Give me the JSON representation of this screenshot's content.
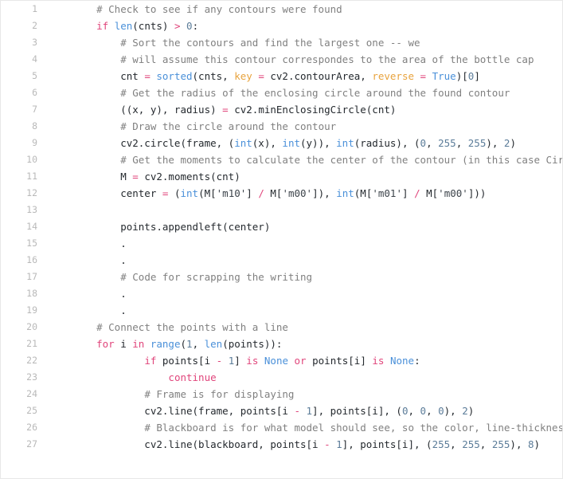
{
  "viewer": {
    "language": "python",
    "first_line": 1,
    "last_line": 27,
    "total_lines": 27,
    "background": "#ffffff",
    "border_color": "#e8e8e8",
    "gutter_color": "#b9b9b9"
  },
  "theme": {
    "comment": "#808080",
    "keyword": "#e0457b",
    "builtin": "#4a90d9",
    "number": "#5b7c99",
    "operator": "#e0457b",
    "parameter": "#e8a33d",
    "string": "#3d444b",
    "plain": "#24292e"
  },
  "lines": [
    {
      "number": "1",
      "text": "    # Check to see if any contours were found",
      "tokens": [
        {
          "t": "    ",
          "c": "pl"
        },
        {
          "t": "# Check to see if any contours were found",
          "c": "cmt"
        }
      ]
    },
    {
      "number": "2",
      "text": "    if len(cnts) > 0:",
      "tokens": [
        {
          "t": "    ",
          "c": "pl"
        },
        {
          "t": "if",
          "c": "kw"
        },
        {
          "t": " ",
          "c": "pl"
        },
        {
          "t": "len",
          "c": "bi"
        },
        {
          "t": "(cnts) ",
          "c": "pl"
        },
        {
          "t": ">",
          "c": "op"
        },
        {
          "t": " ",
          "c": "pl"
        },
        {
          "t": "0",
          "c": "num"
        },
        {
          "t": ":",
          "c": "pl"
        }
      ]
    },
    {
      "number": "3",
      "text": "        # Sort the contours and find the largest one -- we",
      "tokens": [
        {
          "t": "        ",
          "c": "pl"
        },
        {
          "t": "# Sort the contours and find the largest one -- we",
          "c": "cmt"
        }
      ]
    },
    {
      "number": "4",
      "text": "        # will assume this contour correspondes to the area of the bottle cap",
      "tokens": [
        {
          "t": "        ",
          "c": "pl"
        },
        {
          "t": "# will assume this contour correspondes to the area of the bottle cap",
          "c": "cmt"
        }
      ]
    },
    {
      "number": "5",
      "text": "        cnt = sorted(cnts, key = cv2.contourArea, reverse = True)[0]",
      "tokens": [
        {
          "t": "        cnt ",
          "c": "pl"
        },
        {
          "t": "=",
          "c": "op"
        },
        {
          "t": " ",
          "c": "pl"
        },
        {
          "t": "sorted",
          "c": "bi"
        },
        {
          "t": "(cnts, ",
          "c": "pl"
        },
        {
          "t": "key",
          "c": "par"
        },
        {
          "t": " ",
          "c": "pl"
        },
        {
          "t": "=",
          "c": "op"
        },
        {
          "t": " cv2.contourArea, ",
          "c": "pl"
        },
        {
          "t": "reverse",
          "c": "par"
        },
        {
          "t": " ",
          "c": "pl"
        },
        {
          "t": "=",
          "c": "op"
        },
        {
          "t": " ",
          "c": "pl"
        },
        {
          "t": "True",
          "c": "bi"
        },
        {
          "t": ")[",
          "c": "pl"
        },
        {
          "t": "0",
          "c": "num"
        },
        {
          "t": "]",
          "c": "pl"
        }
      ]
    },
    {
      "number": "6",
      "text": "        # Get the radius of the enclosing circle around the found contour",
      "tokens": [
        {
          "t": "        ",
          "c": "pl"
        },
        {
          "t": "# Get the radius of the enclosing circle around the found contour",
          "c": "cmt"
        }
      ]
    },
    {
      "number": "7",
      "text": "        ((x, y), radius) = cv2.minEnclosingCircle(cnt)",
      "tokens": [
        {
          "t": "        ((x, y), radius) ",
          "c": "pl"
        },
        {
          "t": "=",
          "c": "op"
        },
        {
          "t": " cv2.minEnclosingCircle(cnt)",
          "c": "pl"
        }
      ]
    },
    {
      "number": "8",
      "text": "        # Draw the circle around the contour",
      "tokens": [
        {
          "t": "        ",
          "c": "pl"
        },
        {
          "t": "# Draw the circle around the contour",
          "c": "cmt"
        }
      ]
    },
    {
      "number": "9",
      "text": "        cv2.circle(frame, (int(x), int(y)), int(radius), (0, 255, 255), 2)",
      "tokens": [
        {
          "t": "        cv2.circle(frame, (",
          "c": "pl"
        },
        {
          "t": "int",
          "c": "bi"
        },
        {
          "t": "(x), ",
          "c": "pl"
        },
        {
          "t": "int",
          "c": "bi"
        },
        {
          "t": "(y)), ",
          "c": "pl"
        },
        {
          "t": "int",
          "c": "bi"
        },
        {
          "t": "(radius), (",
          "c": "pl"
        },
        {
          "t": "0",
          "c": "num"
        },
        {
          "t": ", ",
          "c": "pl"
        },
        {
          "t": "255",
          "c": "num"
        },
        {
          "t": ", ",
          "c": "pl"
        },
        {
          "t": "255",
          "c": "num"
        },
        {
          "t": "), ",
          "c": "pl"
        },
        {
          "t": "2",
          "c": "num"
        },
        {
          "t": ")",
          "c": "pl"
        }
      ]
    },
    {
      "number": "10",
      "text": "        # Get the moments to calculate the center of the contour (in this case Circle)",
      "tokens": [
        {
          "t": "        ",
          "c": "pl"
        },
        {
          "t": "# Get the moments to calculate the center of the contour (in this case Circle)",
          "c": "cmt"
        }
      ]
    },
    {
      "number": "11",
      "text": "        M = cv2.moments(cnt)",
      "tokens": [
        {
          "t": "        M ",
          "c": "pl"
        },
        {
          "t": "=",
          "c": "op"
        },
        {
          "t": " cv2.moments(cnt)",
          "c": "pl"
        }
      ]
    },
    {
      "number": "12",
      "text": "        center = (int(M['m10'] / M['m00']), int(M['m01'] / M['m00']))",
      "tokens": [
        {
          "t": "        center ",
          "c": "pl"
        },
        {
          "t": "=",
          "c": "op"
        },
        {
          "t": " (",
          "c": "pl"
        },
        {
          "t": "int",
          "c": "bi"
        },
        {
          "t": "(M[",
          "c": "pl"
        },
        {
          "t": "'m10'",
          "c": "str"
        },
        {
          "t": "] ",
          "c": "pl"
        },
        {
          "t": "/",
          "c": "op"
        },
        {
          "t": " M[",
          "c": "pl"
        },
        {
          "t": "'m00'",
          "c": "str"
        },
        {
          "t": "]), ",
          "c": "pl"
        },
        {
          "t": "int",
          "c": "bi"
        },
        {
          "t": "(M[",
          "c": "pl"
        },
        {
          "t": "'m01'",
          "c": "str"
        },
        {
          "t": "] ",
          "c": "pl"
        },
        {
          "t": "/",
          "c": "op"
        },
        {
          "t": " M[",
          "c": "pl"
        },
        {
          "t": "'m00'",
          "c": "str"
        },
        {
          "t": "]))",
          "c": "pl"
        }
      ]
    },
    {
      "number": "13",
      "text": "",
      "tokens": []
    },
    {
      "number": "14",
      "text": "        points.appendleft(center)",
      "tokens": [
        {
          "t": "        points.appendleft(center)",
          "c": "pl"
        }
      ]
    },
    {
      "number": "15",
      "text": "        .",
      "tokens": [
        {
          "t": "        .",
          "c": "pl"
        }
      ]
    },
    {
      "number": "16",
      "text": "        .",
      "tokens": [
        {
          "t": "        .",
          "c": "pl"
        }
      ]
    },
    {
      "number": "17",
      "text": "        # Code for scrapping the writing",
      "tokens": [
        {
          "t": "        ",
          "c": "pl"
        },
        {
          "t": "# Code for scrapping the writing",
          "c": "cmt"
        }
      ]
    },
    {
      "number": "18",
      "text": "        .",
      "tokens": [
        {
          "t": "        .",
          "c": "pl"
        }
      ]
    },
    {
      "number": "19",
      "text": "        .",
      "tokens": [
        {
          "t": "        .",
          "c": "pl"
        }
      ]
    },
    {
      "number": "20",
      "text": "    # Connect the points with a line",
      "tokens": [
        {
          "t": "    ",
          "c": "pl"
        },
        {
          "t": "# Connect the points with a line",
          "c": "cmt"
        }
      ]
    },
    {
      "number": "21",
      "text": "    for i in range(1, len(points)):",
      "tokens": [
        {
          "t": "    ",
          "c": "pl"
        },
        {
          "t": "for",
          "c": "kw"
        },
        {
          "t": " i ",
          "c": "pl"
        },
        {
          "t": "in",
          "c": "kw"
        },
        {
          "t": " ",
          "c": "pl"
        },
        {
          "t": "range",
          "c": "bi"
        },
        {
          "t": "(",
          "c": "pl"
        },
        {
          "t": "1",
          "c": "num"
        },
        {
          "t": ", ",
          "c": "pl"
        },
        {
          "t": "len",
          "c": "bi"
        },
        {
          "t": "(points)):",
          "c": "pl"
        }
      ]
    },
    {
      "number": "22",
      "text": "            if points[i - 1] is None or points[i] is None:",
      "tokens": [
        {
          "t": "            ",
          "c": "pl"
        },
        {
          "t": "if",
          "c": "kw"
        },
        {
          "t": " points[i ",
          "c": "pl"
        },
        {
          "t": "-",
          "c": "op"
        },
        {
          "t": " ",
          "c": "pl"
        },
        {
          "t": "1",
          "c": "num"
        },
        {
          "t": "] ",
          "c": "pl"
        },
        {
          "t": "is",
          "c": "kw"
        },
        {
          "t": " ",
          "c": "pl"
        },
        {
          "t": "None",
          "c": "bi"
        },
        {
          "t": " ",
          "c": "pl"
        },
        {
          "t": "or",
          "c": "kw"
        },
        {
          "t": " points[i] ",
          "c": "pl"
        },
        {
          "t": "is",
          "c": "kw"
        },
        {
          "t": " ",
          "c": "pl"
        },
        {
          "t": "None",
          "c": "bi"
        },
        {
          "t": ":",
          "c": "pl"
        }
      ]
    },
    {
      "number": "23",
      "text": "                continue",
      "tokens": [
        {
          "t": "                ",
          "c": "pl"
        },
        {
          "t": "continue",
          "c": "kw"
        }
      ]
    },
    {
      "number": "24",
      "text": "            # Frame is for displaying",
      "tokens": [
        {
          "t": "            ",
          "c": "pl"
        },
        {
          "t": "# Frame is for displaying",
          "c": "cmt"
        }
      ]
    },
    {
      "number": "25",
      "text": "            cv2.line(frame, points[i - 1], points[i], (0, 0, 0), 2)",
      "tokens": [
        {
          "t": "            cv2.line(frame, points[i ",
          "c": "pl"
        },
        {
          "t": "-",
          "c": "op"
        },
        {
          "t": " ",
          "c": "pl"
        },
        {
          "t": "1",
          "c": "num"
        },
        {
          "t": "], points[i], (",
          "c": "pl"
        },
        {
          "t": "0",
          "c": "num"
        },
        {
          "t": ", ",
          "c": "pl"
        },
        {
          "t": "0",
          "c": "num"
        },
        {
          "t": ", ",
          "c": "pl"
        },
        {
          "t": "0",
          "c": "num"
        },
        {
          "t": "), ",
          "c": "pl"
        },
        {
          "t": "2",
          "c": "num"
        },
        {
          "t": ")",
          "c": "pl"
        }
      ]
    },
    {
      "number": "26",
      "text": "            # Blackboard is for what model should see, so the color, line-thickness is different",
      "tokens": [
        {
          "t": "            ",
          "c": "pl"
        },
        {
          "t": "# Blackboard is for what model should see, so the color, line-thickness is different",
          "c": "cmt"
        }
      ]
    },
    {
      "number": "27",
      "text": "            cv2.line(blackboard, points[i - 1], points[i], (255, 255, 255), 8)",
      "tokens": [
        {
          "t": "            cv2.line(blackboard, points[i ",
          "c": "pl"
        },
        {
          "t": "-",
          "c": "op"
        },
        {
          "t": " ",
          "c": "pl"
        },
        {
          "t": "1",
          "c": "num"
        },
        {
          "t": "], points[i], (",
          "c": "pl"
        },
        {
          "t": "255",
          "c": "num"
        },
        {
          "t": ", ",
          "c": "pl"
        },
        {
          "t": "255",
          "c": "num"
        },
        {
          "t": ", ",
          "c": "pl"
        },
        {
          "t": "255",
          "c": "num"
        },
        {
          "t": "), ",
          "c": "pl"
        },
        {
          "t": "8",
          "c": "num"
        },
        {
          "t": ")",
          "c": "pl"
        }
      ]
    }
  ]
}
